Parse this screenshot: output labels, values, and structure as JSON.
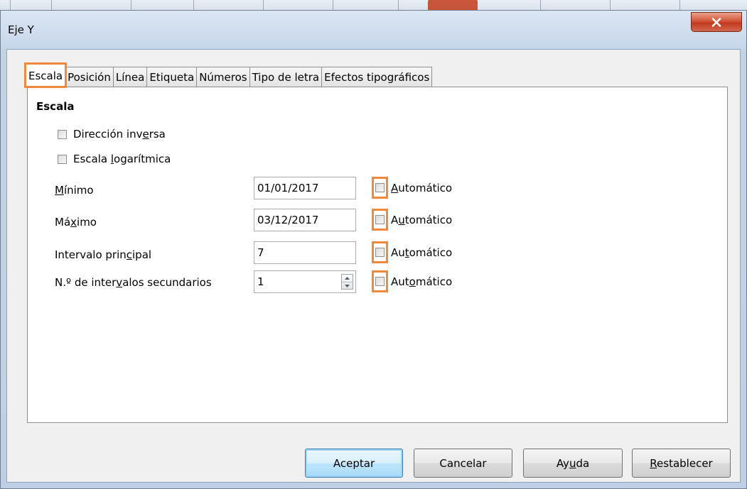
{
  "window": {
    "title": "Eje Y"
  },
  "tabs": [
    {
      "label": "Escala",
      "active": true
    },
    {
      "label": "Posición",
      "active": false
    },
    {
      "label": "Línea",
      "active": false
    },
    {
      "label": "Etiqueta",
      "active": false
    },
    {
      "label": "Números",
      "active": false
    },
    {
      "label": "Tipo de letra",
      "active": false
    },
    {
      "label": "Efectos tipográficos",
      "active": false
    }
  ],
  "scale": {
    "section_title": "Escala",
    "reverse_direction": {
      "pre": "Dirección inv",
      "u": "e",
      "post": "rsa",
      "checked": false
    },
    "log_scale": {
      "pre": "Escala ",
      "u": "l",
      "post": "ogarítmica",
      "checked": false
    },
    "fields": [
      {
        "label_pre": "",
        "label_u": "M",
        "label_post": "ínimo",
        "value": "01/01/2017",
        "spin": false,
        "auto": {
          "pre": "",
          "u": "A",
          "post": "utomático",
          "checked": false
        }
      },
      {
        "label_pre": "Má",
        "label_u": "x",
        "label_post": "imo",
        "value": "03/12/2017",
        "spin": false,
        "auto": {
          "pre": "A",
          "u": "u",
          "post": "tomático",
          "checked": false
        }
      },
      {
        "label_pre": "Intervalo prin",
        "label_u": "c",
        "label_post": "ipal",
        "value": "7",
        "spin": false,
        "auto": {
          "pre": "Au",
          "u": "t",
          "post": "omático",
          "checked": false
        }
      },
      {
        "label_pre": "N.º de inter",
        "label_u": "v",
        "label_post": "alos secundarios",
        "value": "1",
        "spin": true,
        "auto": {
          "pre": "Aut",
          "u": "o",
          "post": "mático",
          "checked": false
        }
      }
    ]
  },
  "buttons": {
    "ok": "Aceptar",
    "cancel": "Cancelar",
    "help_pre": "Ay",
    "help_u": "u",
    "help_post": "da",
    "reset_u": "R",
    "reset_post": "establecer"
  },
  "colors": {
    "highlight": "#f08a3a",
    "close_button": "#c23a1f"
  }
}
